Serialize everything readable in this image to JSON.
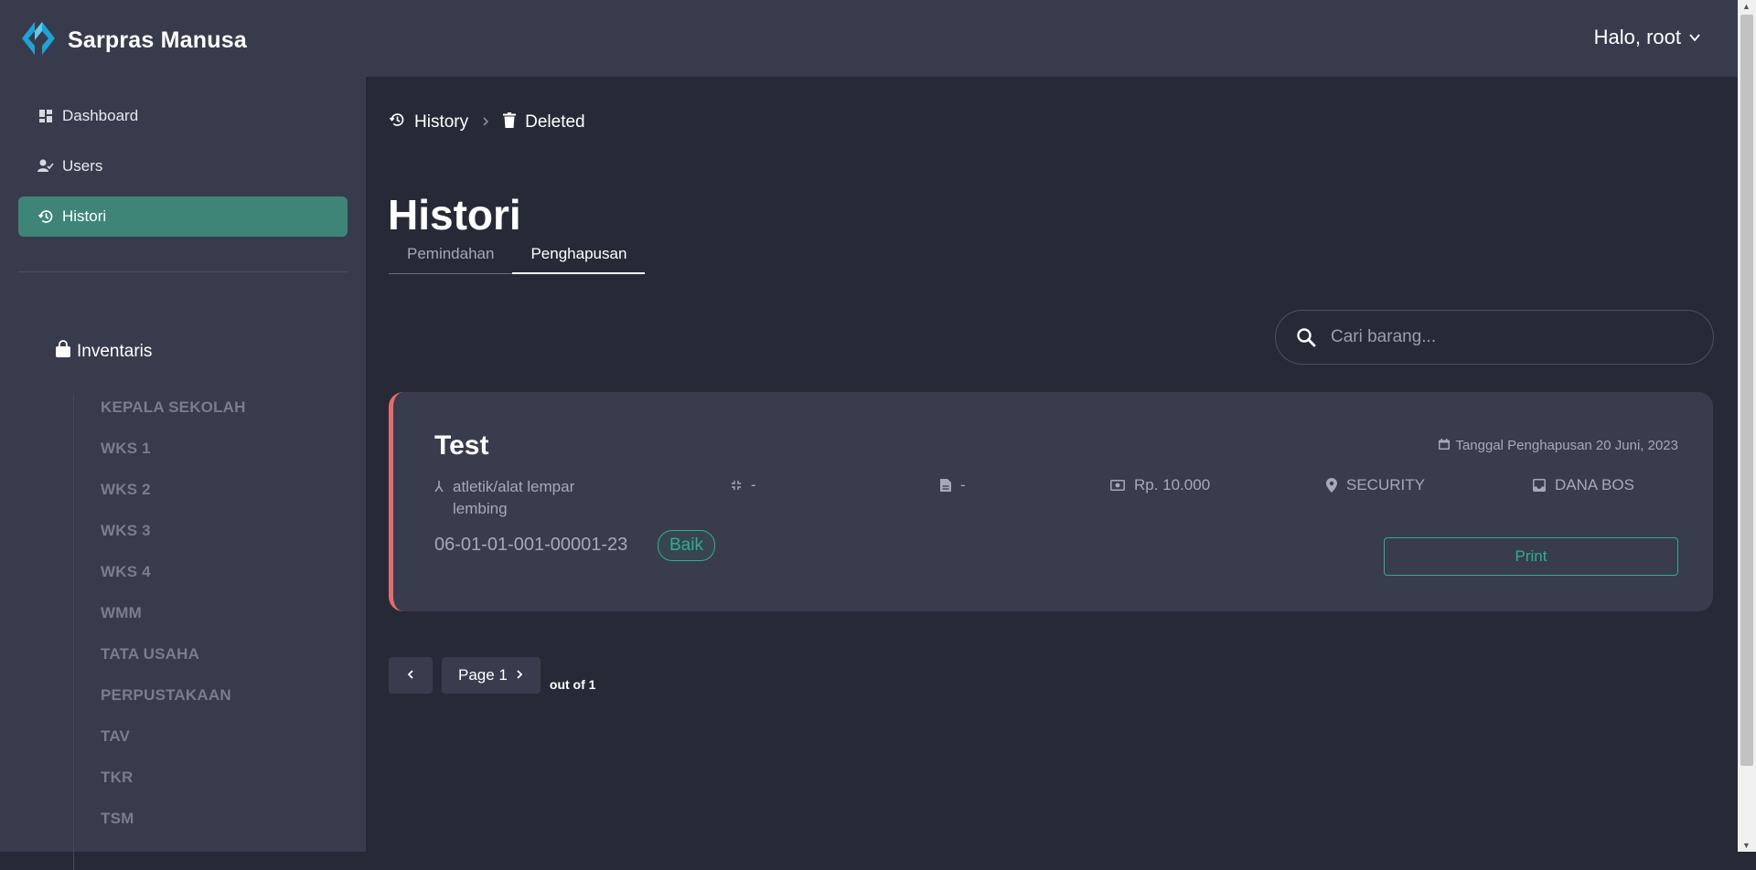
{
  "app": {
    "name": "Sarpras Manusa",
    "greeting": "Halo, root"
  },
  "sidebar": {
    "items": [
      {
        "label": "Dashboard",
        "icon": "dashboard-icon"
      },
      {
        "label": "Users",
        "icon": "user-check-icon"
      },
      {
        "label": "Histori",
        "icon": "history-icon",
        "active": true
      }
    ],
    "inventory": {
      "title": "Inventaris",
      "items": [
        "KEPALA SEKOLAH",
        "WKS 1",
        "WKS 2",
        "WKS 3",
        "WKS 4",
        "WMM",
        "TATA USAHA",
        "PERPUSTAKAAN",
        "TAV",
        "TKR",
        "TSM"
      ]
    }
  },
  "breadcrumb": {
    "items": [
      "History",
      "Deleted"
    ]
  },
  "page": {
    "title": "Histori"
  },
  "tabs": [
    {
      "label": "Pemindahan",
      "active": false
    },
    {
      "label": "Penghapusan",
      "active": true
    }
  ],
  "search": {
    "placeholder": "Cari barang...",
    "value": ""
  },
  "records": [
    {
      "name": "Test",
      "deleted_date": "Tanggal Penghapusan 20 Juni, 2023",
      "category": "atletik/alat lempar lembing",
      "size": "-",
      "document": "-",
      "price": "Rp. 10.000",
      "location": "SECURITY",
      "fund_source": "DANA BOS",
      "code": "06-01-01-001-00001-23",
      "condition": "Baik",
      "print_label": "Print"
    }
  ],
  "pagination": {
    "page_label": "Page 1",
    "total_label": "out of 1"
  },
  "colors": {
    "background": "#272a36",
    "panel": "#383b4c",
    "card": "#393c4d",
    "accent": "#3f8577",
    "success": "#2fae8e",
    "danger_border": "#e26d6d"
  }
}
